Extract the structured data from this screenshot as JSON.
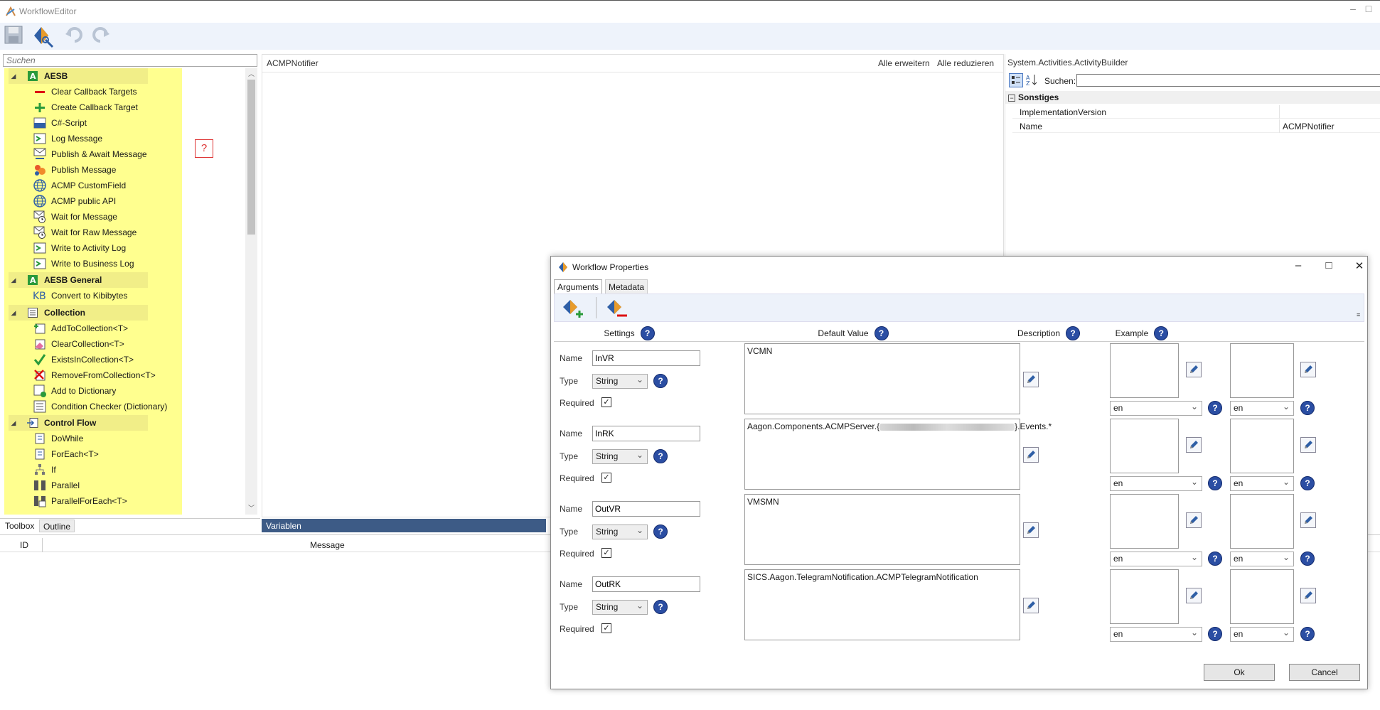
{
  "app": {
    "title": "WorkflowEditor"
  },
  "left": {
    "search_placeholder": "Suchen",
    "categories": [
      {
        "label": "AESB",
        "items": [
          "Clear Callback Targets",
          "Create Callback Target",
          "C#-Script",
          "Log Message",
          "Publish & Await Message",
          "Publish Message",
          "ACMP CustomField",
          "ACMP public API",
          "Wait for Message",
          "Wait for Raw Message",
          "Write to Activity Log",
          "Write to Business Log"
        ]
      },
      {
        "label": "AESB General",
        "items": [
          "Convert to Kibibytes"
        ]
      },
      {
        "label": "Collection",
        "items": [
          "AddToCollection<T>",
          "ClearCollection<T>",
          "ExistsInCollection<T>",
          "RemoveFromCollection<T>",
          "Add to Dictionary",
          "Condition Checker (Dictionary)"
        ]
      },
      {
        "label": "Control Flow",
        "items": [
          "DoWhile",
          "ForEach<T>",
          "If",
          "Parallel",
          "ParallelForEach<T>"
        ]
      }
    ],
    "tabs": [
      "Toolbox",
      "Outline"
    ],
    "help_glyph": "?"
  },
  "center": {
    "header": "ACMPNotifier",
    "expand_all": "Alle erweitern",
    "collapse_all": "Alle reduzieren",
    "variables_tab": "Variablen"
  },
  "properties": {
    "header": "System.Activities.ActivityBuilder",
    "search_label": "Suchen:",
    "section": "Sonstiges",
    "rows": [
      {
        "name": "ImplementationVersion",
        "value": ""
      },
      {
        "name": "Name",
        "value": "ACMPNotifier"
      }
    ]
  },
  "bottom": {
    "col_id": "ID",
    "col_message": "Message"
  },
  "dialog": {
    "title": "Workflow Properties",
    "tabs": [
      "Arguments",
      "Metadata"
    ],
    "headers": {
      "settings": "Settings",
      "default_value": "Default Value",
      "description": "Description",
      "example": "Example"
    },
    "labels": {
      "name": "Name",
      "type": "Type",
      "required": "Required"
    },
    "help_glyph": "?",
    "args": [
      {
        "name": "InVR",
        "type": "String",
        "required": true,
        "default": "VCMN",
        "default_suffix": "",
        "desc_lang": "en",
        "ex_lang": "en"
      },
      {
        "name": "InRK",
        "type": "String",
        "required": true,
        "default": "Aagon.Components.ACMPServer.{",
        "default_suffix": "}.Events.*",
        "desc_lang": "en",
        "ex_lang": "en"
      },
      {
        "name": "OutVR",
        "type": "String",
        "required": true,
        "default": "VMSMN",
        "default_suffix": "",
        "desc_lang": "en",
        "ex_lang": "en"
      },
      {
        "name": "OutRK",
        "type": "String",
        "required": true,
        "default": "SICS.Aagon.TelegramNotification.ACMPTelegramNotification",
        "default_suffix": "",
        "desc_lang": "en",
        "ex_lang": "en"
      }
    ],
    "ok": "Ok",
    "cancel": "Cancel"
  }
}
